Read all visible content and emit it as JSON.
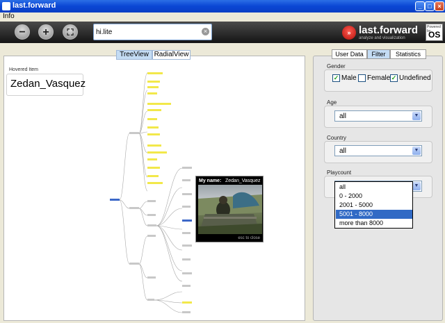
{
  "window": {
    "title": "last.forward",
    "min": "_",
    "max": "□",
    "close": "×"
  },
  "menu": {
    "info": "Info"
  },
  "toolbar": {
    "zoom_out": "−",
    "zoom_in": "+",
    "fit": "⛶",
    "search_value": "hi.lite",
    "clear": "×"
  },
  "brand": {
    "name": "last.forward",
    "tagline": "analyze and visualization",
    "logo_glyph": "»",
    "os_small": "Powered by",
    "os_text": "OS"
  },
  "views": {
    "tabs": [
      {
        "label": "TreeView",
        "active": true
      },
      {
        "label": "RadialView",
        "active": false
      }
    ]
  },
  "hovered": {
    "label": "Hovered Item",
    "value": "Zedan_Vasquez"
  },
  "popup": {
    "label": "My name:",
    "name": "Zedan_Vasquez",
    "hint": "esc to close"
  },
  "panel": {
    "tabs": [
      {
        "label": "User Data",
        "active": false
      },
      {
        "label": "Filter",
        "active": true
      },
      {
        "label": "Statistics",
        "active": false
      }
    ]
  },
  "filter": {
    "gender": {
      "title": "Gender",
      "options": [
        {
          "label": "Male",
          "checked": true
        },
        {
          "label": "Female",
          "checked": false
        },
        {
          "label": "Undefined",
          "checked": true
        }
      ]
    },
    "age": {
      "title": "Age",
      "value": "all"
    },
    "country": {
      "title": "Country",
      "value": "all"
    },
    "playcount": {
      "title": "Playcount",
      "value": "all",
      "options": [
        "all",
        "0 - 2000",
        "2001 - 5000",
        "5001 - 8000",
        "more than 8000"
      ],
      "highlighted_index": 3
    }
  },
  "colors": {
    "highlight": "#f2e84a",
    "selection": "#316ac5",
    "accent": "#c4dcf4"
  }
}
